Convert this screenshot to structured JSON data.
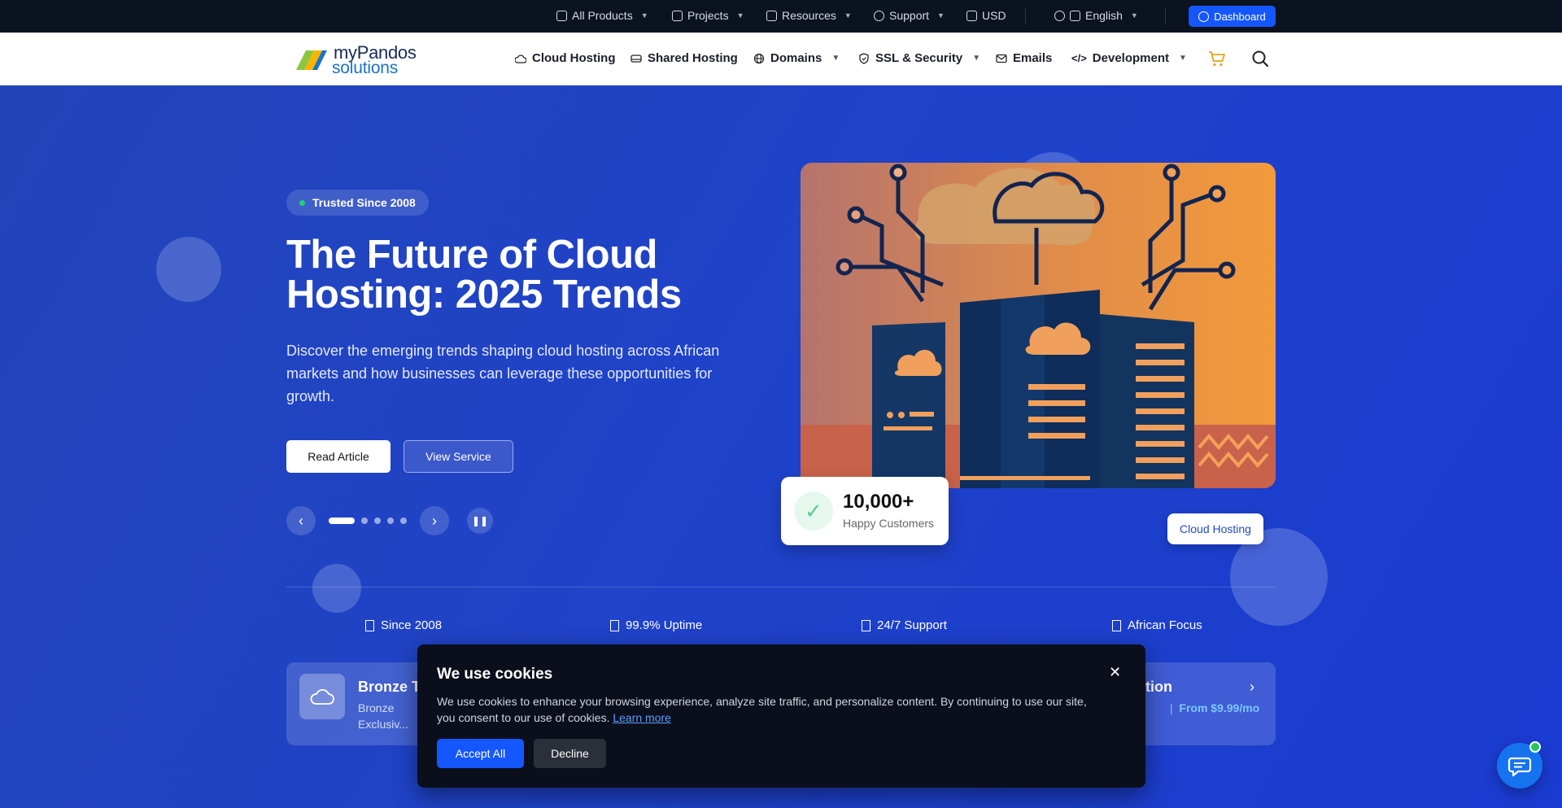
{
  "topbar": {
    "all_products": "All Products",
    "projects": "Projects",
    "resources": "Resources",
    "support": "Support",
    "currency": "USD",
    "language": "English",
    "dashboard": "Dashboard"
  },
  "logo": {
    "line1": "myPandos",
    "line2": "solutions"
  },
  "nav": {
    "cloud_hosting": "Cloud Hosting",
    "shared_hosting": "Shared Hosting",
    "domains": "Domains",
    "ssl_security": "SSL & Security",
    "emails": "Emails",
    "development": "Development"
  },
  "hero": {
    "badge": "Trusted Since 2008",
    "title": "The Future of Cloud Hosting: 2025 Trends",
    "description": "Discover the emerging trends shaping cloud hosting across African markets and how businesses can leverage these opportunities for growth.",
    "read_btn": "Read Article",
    "view_btn": "View Service",
    "slides_total": 5,
    "active_slide": 1,
    "stat_number": "10,000+",
    "stat_label": "Happy Customers",
    "image_tag": "Cloud Hosting"
  },
  "features": [
    "Since 2008",
    "99.9% Uptime",
    "24/7 Support",
    "African Focus"
  ],
  "service_cards": {
    "left_title": "Bronze T",
    "left_sub": "Bronze Exclusiv...",
    "right_title": "tion",
    "right_price": "From $9.99/mo"
  },
  "cookie": {
    "title": "We use cookies",
    "text": "We use cookies to enhance your browsing experience, analyze site traffic, and personalize content. By continuing to use our site, you consent to our use of cookies.",
    "learn_more": "Learn more",
    "accept": "Accept All",
    "decline": "Decline"
  },
  "colors": {
    "accent": "#1557ff",
    "hero": "#1f43c9",
    "orange": "#f0903a",
    "navy": "#0b1220"
  }
}
